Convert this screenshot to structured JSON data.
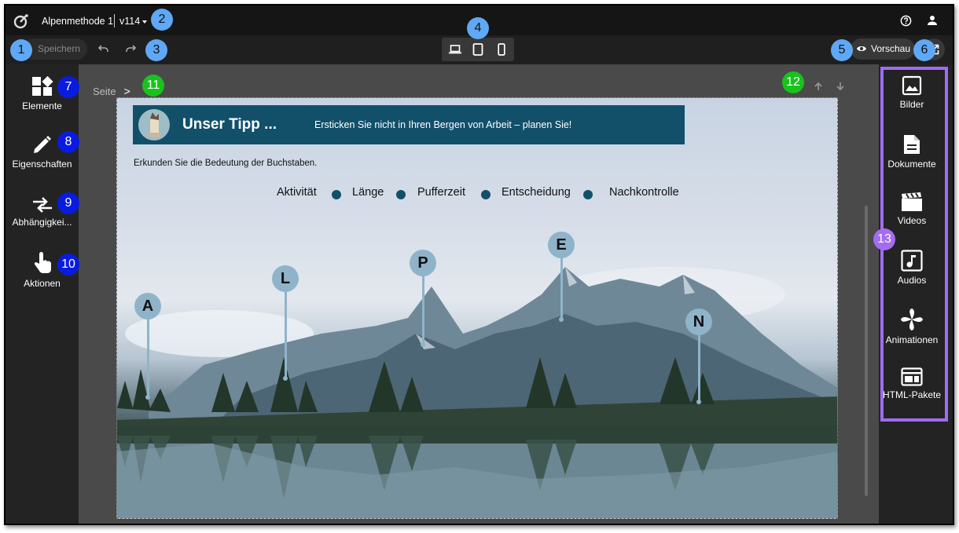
{
  "header": {
    "project_title": "Alpenmethode 1",
    "version": "v114"
  },
  "toolbar": {
    "save_label": "Speichern",
    "preview_label": "Vorschau",
    "devices": [
      "laptop-icon",
      "tablet-icon",
      "phone-icon"
    ]
  },
  "left_panel": {
    "items": [
      {
        "label": "Elemente",
        "icon": "widgets-icon"
      },
      {
        "label": "Eigenschaften",
        "icon": "pencil-icon"
      },
      {
        "label": "Abhängigkei...",
        "icon": "swap-arrows-icon"
      },
      {
        "label": "Aktionen",
        "icon": "touch-icon"
      }
    ]
  },
  "breadcrumb": {
    "root": "Seite",
    "separator": ">"
  },
  "content": {
    "tip_title": "Unser Tipp ...",
    "tip_text": "Ersticken Sie nicht in Ihren Bergen von Arbeit – planen Sie!",
    "intro": "Erkunden Sie die Bedeutung der Buchstaben.",
    "legend": [
      "Aktivität",
      "Länge",
      "Pufferzeit",
      "Entscheidung",
      "Nachkontrolle"
    ],
    "pins": [
      "A",
      "L",
      "P",
      "E",
      "N"
    ]
  },
  "right_panel": {
    "items": [
      {
        "label": "Bilder",
        "icon": "image-icon"
      },
      {
        "label": "Dokumente",
        "icon": "document-icon"
      },
      {
        "label": "Videos",
        "icon": "clapperboard-icon"
      },
      {
        "label": "Audios",
        "icon": "music-note-icon"
      },
      {
        "label": "Animationen",
        "icon": "pinwheel-icon"
      },
      {
        "label": "HTML-Pakete",
        "icon": "web-package-icon"
      }
    ]
  },
  "callouts": [
    "1",
    "2",
    "3",
    "4",
    "5",
    "6",
    "7",
    "8",
    "9",
    "10",
    "11",
    "12",
    "13"
  ],
  "colors": {
    "accent_blue": "#12506a",
    "callout_light_blue": "#5fa8f5",
    "callout_dark_blue": "#0a1be0",
    "callout_green": "#19c21c",
    "callout_purple": "#a56cf0"
  }
}
